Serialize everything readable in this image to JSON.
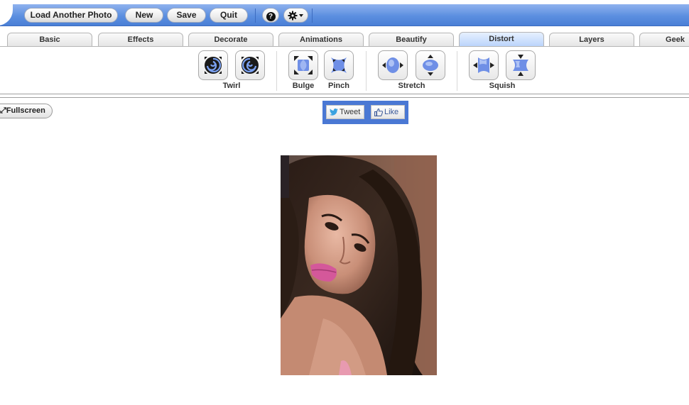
{
  "toolbar": {
    "load_label": "Load Another Photo",
    "new_label": "New",
    "save_label": "Save",
    "quit_label": "Quit",
    "help_label": "?",
    "settings_icon": "gear-icon"
  },
  "tabs": [
    {
      "label": "Basic"
    },
    {
      "label": "Effects"
    },
    {
      "label": "Decorate"
    },
    {
      "label": "Animations"
    },
    {
      "label": "Beautify"
    },
    {
      "label": "Distort",
      "active": true
    },
    {
      "label": "Layers"
    },
    {
      "label": "Geek"
    }
  ],
  "tools": {
    "twirl_label": "Twirl",
    "bulge_label": "Bulge",
    "pinch_label": "Pinch",
    "stretch_label": "Stretch",
    "squish_label": "Squish"
  },
  "fullscreen_label": "Fullscreen",
  "social": {
    "tweet_label": "Tweet",
    "like_label": "Like"
  },
  "colors": {
    "toolbar_blue": "#5c8fe0",
    "tool_blue": "#6f8fe6",
    "social_blue": "#4a78d4"
  }
}
